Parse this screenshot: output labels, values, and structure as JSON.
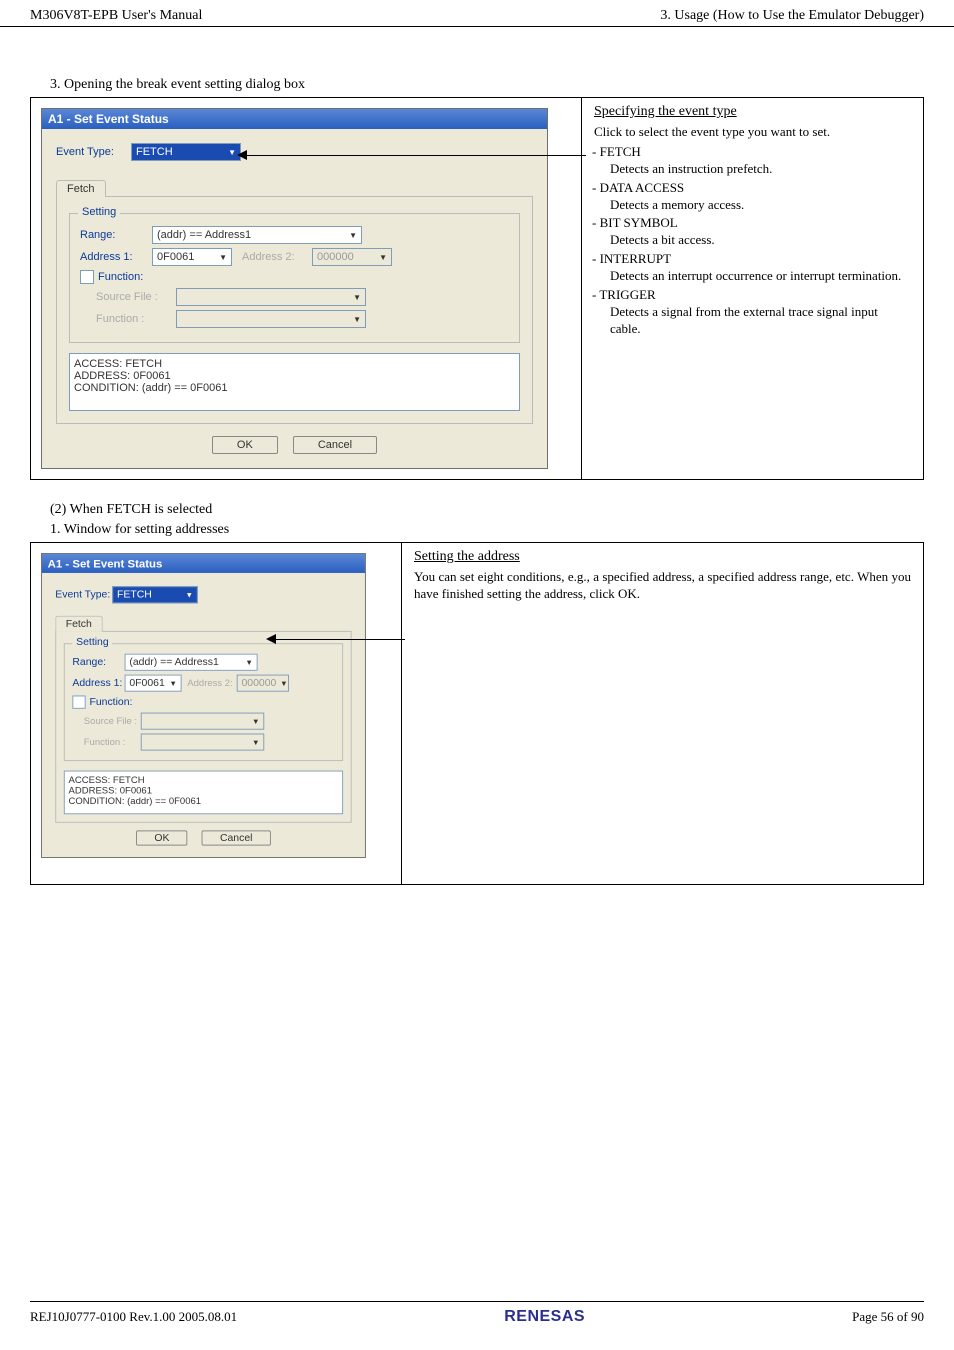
{
  "header": {
    "left": "M306V8T-EPB User's Manual",
    "right": "3. Usage (How to Use the Emulator Debugger)"
  },
  "sec1": {
    "title": "3. Opening the break event setting dialog box",
    "dlg": {
      "title": "A1 - Set Event Status",
      "event_type_label": "Event Type:",
      "event_type_value": "FETCH",
      "tab": "Fetch",
      "group": "Setting",
      "range_label": "Range:",
      "range_value": "(addr) == Address1",
      "addr1_label": "Address 1:",
      "addr1_value": "0F0061",
      "addr2_label": "Address 2:",
      "addr2_value": "000000",
      "func_check": "Function:",
      "source_label": "Source File :",
      "func_label": "Function :",
      "status": "ACCESS: FETCH\nADDRESS: 0F0061\nCONDITION: (addr) == 0F0061",
      "ok": "OK",
      "cancel": "Cancel"
    },
    "explain": {
      "title": "Specifying the event type",
      "lead": "Click to select the event type you want to set.",
      "items": [
        {
          "term": "FETCH",
          "sub": "Detects an instruction prefetch."
        },
        {
          "term": "DATA ACCESS",
          "sub": "Detects a memory access."
        },
        {
          "term": "BIT SYMBOL",
          "sub": "Detects a bit access."
        },
        {
          "term": "INTERRUPT",
          "sub": "Detects an interrupt occurrence or interrupt termination."
        },
        {
          "term": "TRIGGER",
          "sub": "Detects a signal from the external trace signal input cable."
        }
      ]
    }
  },
  "sec2": {
    "heading": "(2) When FETCH is selected",
    "title": "1. Window for setting addresses",
    "explain": {
      "title": "Setting the address",
      "body": "You can set eight conditions, e.g., a specified address, a specified address range, etc. When you have finished setting the address, click OK."
    }
  },
  "footer": {
    "left": "REJ10J0777-0100   Rev.1.00   2005.08.01",
    "brand": "RENESAS",
    "right": "Page 56 of 90"
  }
}
